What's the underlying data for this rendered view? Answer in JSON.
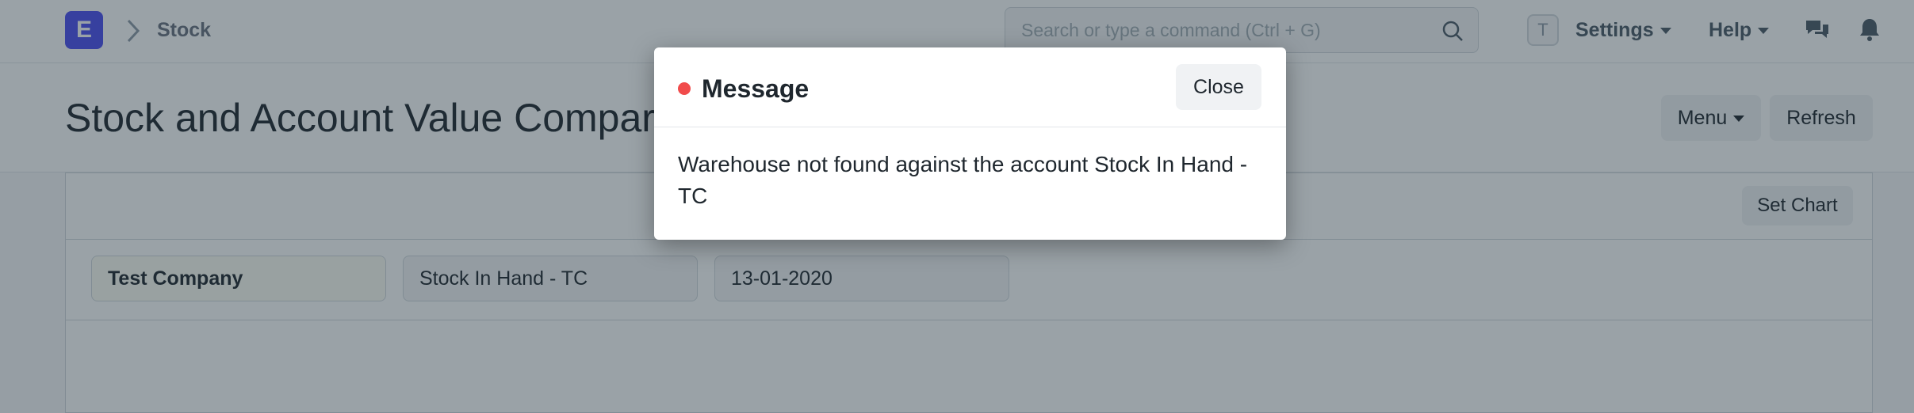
{
  "navbar": {
    "logo_letter": "E",
    "breadcrumb": "Stock",
    "search_placeholder": "Search or type a command (Ctrl + G)",
    "avatar_letter": "T",
    "settings_label": "Settings",
    "help_label": "Help"
  },
  "page": {
    "title": "Stock and Account Value Comparison",
    "menu_label": "Menu",
    "refresh_label": "Refresh",
    "set_chart_label": "Set Chart"
  },
  "filters": {
    "company": "Test Company",
    "account": "Stock In Hand - TC",
    "as_on_date": "13-01-2020"
  },
  "modal": {
    "title": "Message",
    "close_label": "Close",
    "message": "Warehouse not found against the account Stock In Hand - TC",
    "indicator_color": "#f14b4b"
  },
  "colors": {
    "brand": "#4b4df0"
  }
}
